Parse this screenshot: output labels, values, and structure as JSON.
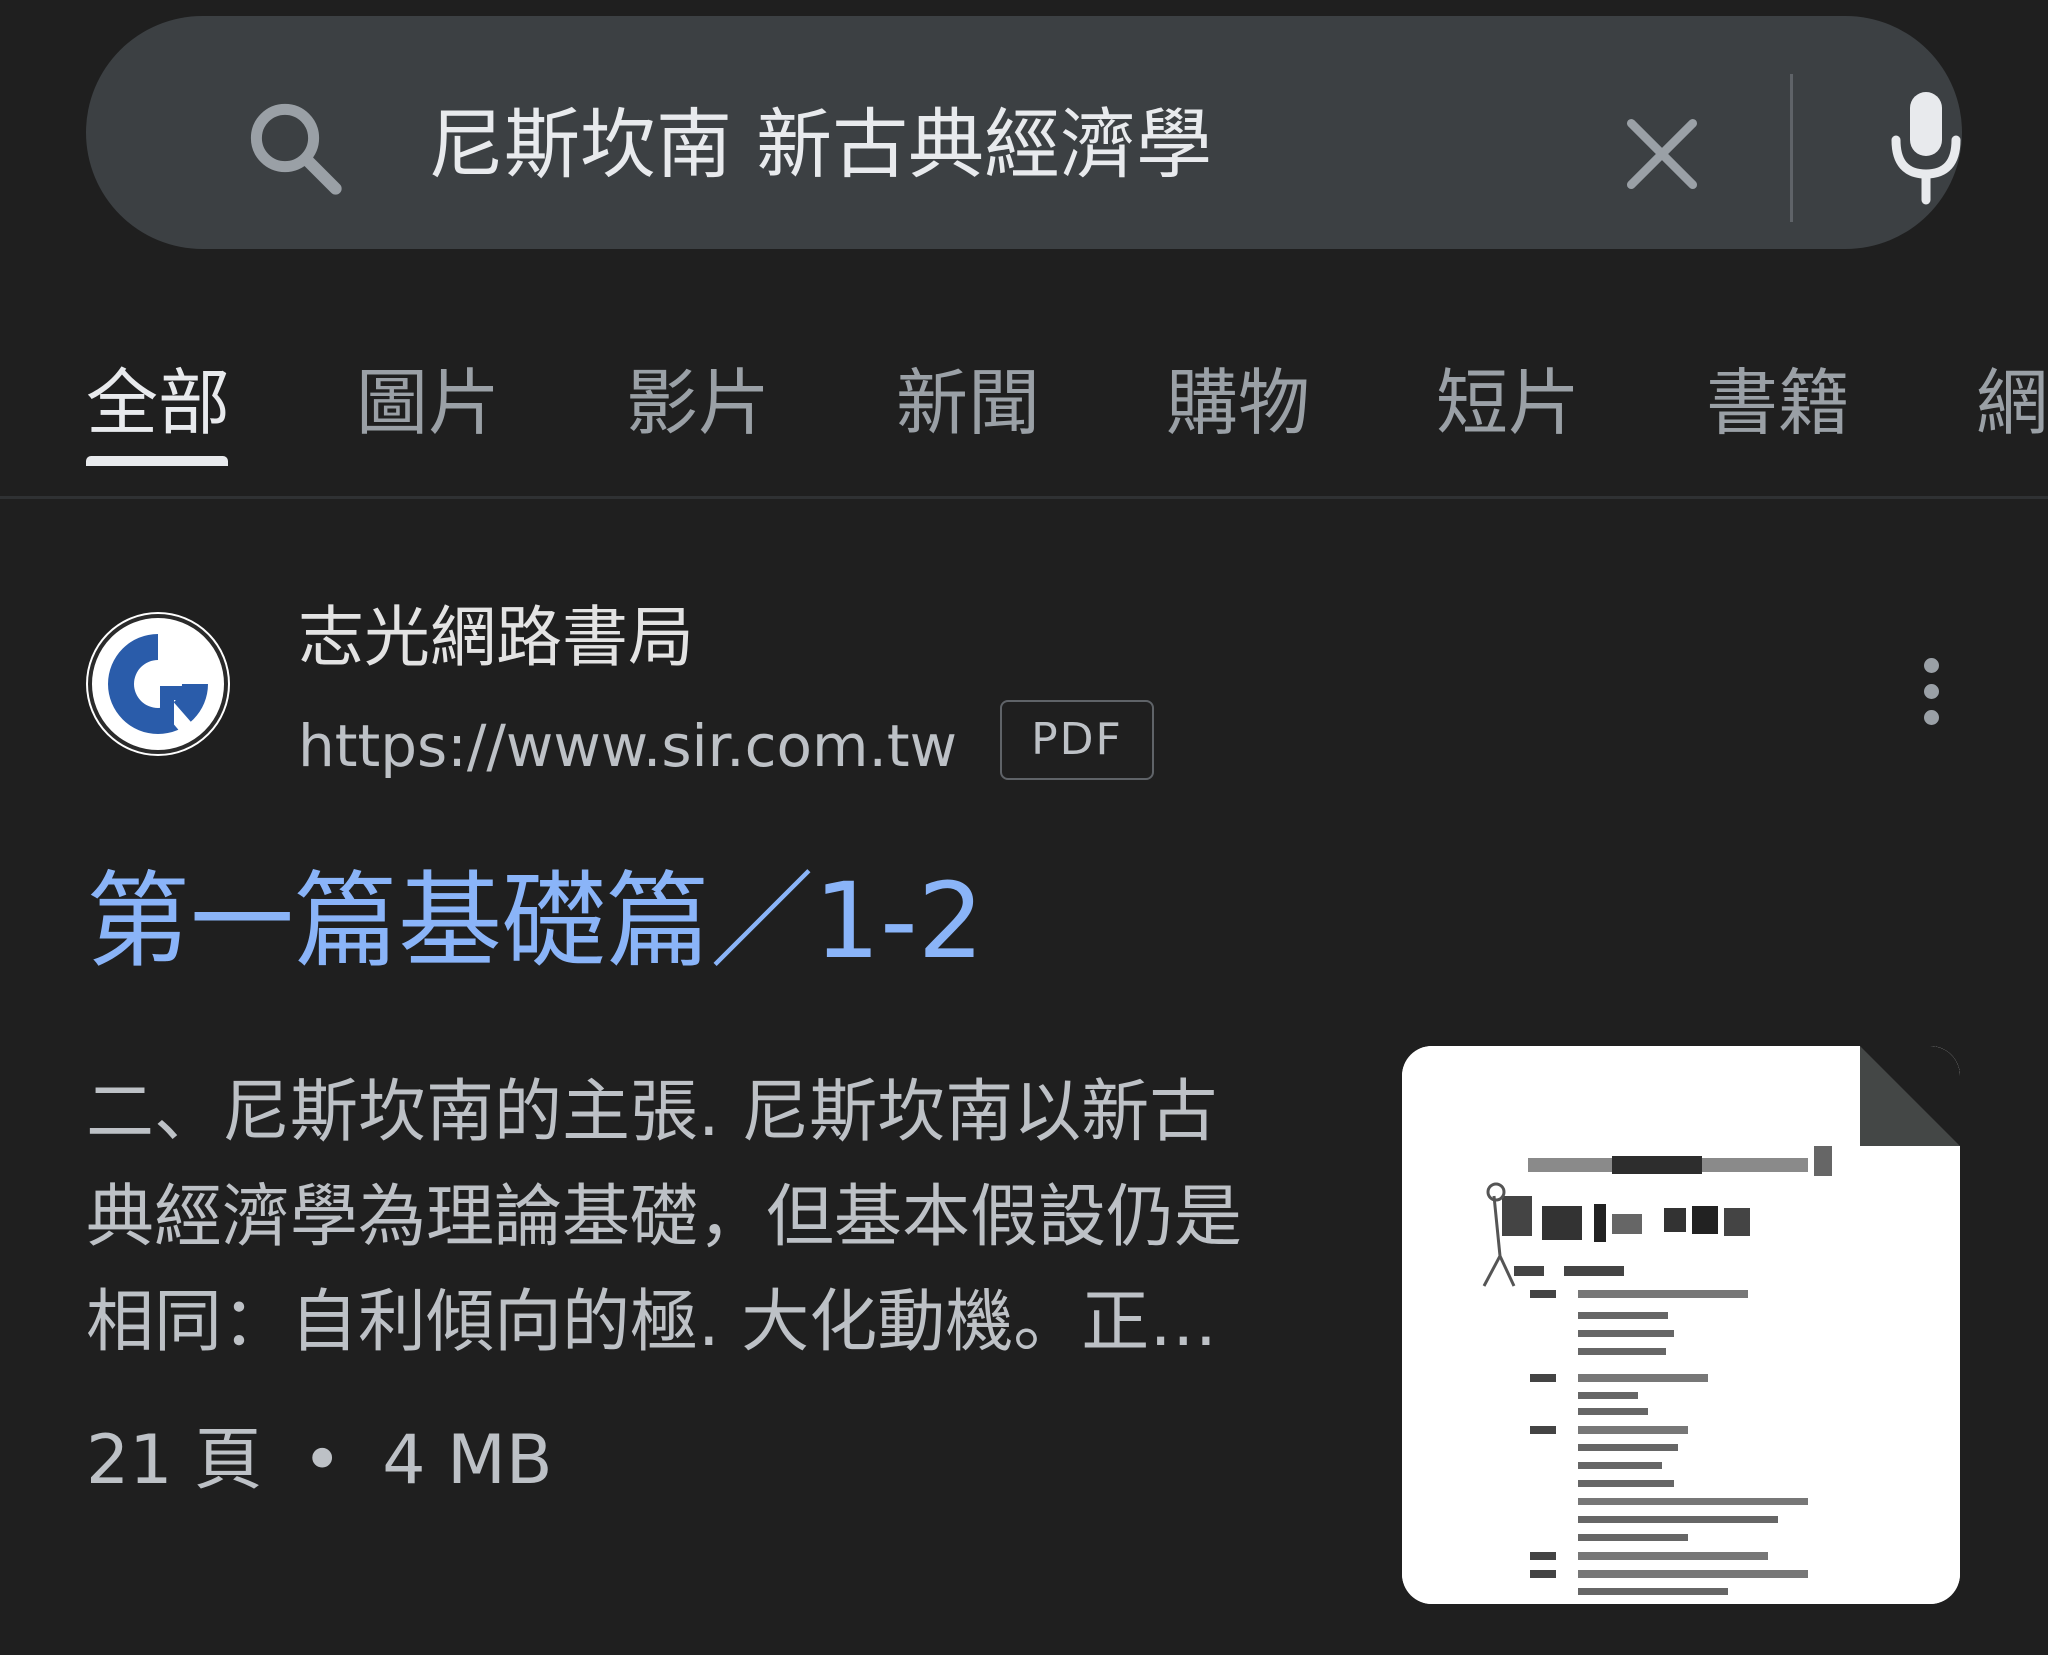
{
  "search": {
    "query": "尼斯坎南 新古典經濟學",
    "search_icon": "search-icon",
    "clear_icon": "close-icon",
    "mic_icon": "microphone-icon"
  },
  "tabs": [
    {
      "label": "全部",
      "active": true
    },
    {
      "label": "圖片"
    },
    {
      "label": "影片"
    },
    {
      "label": "新聞"
    },
    {
      "label": "購物"
    },
    {
      "label": "短片"
    },
    {
      "label": "書籍"
    },
    {
      "label": "網"
    }
  ],
  "result": {
    "site_name": "志光網路書局",
    "url": "https://www.sir.com.tw",
    "badge": "PDF",
    "title": "第一篇基礎篇／1-2",
    "snippet_lines": [
      "二、尼斯坎南的主張. 尼斯坎南以新古",
      "典經濟學為理論基礎，但基本假設仍是",
      "相同：自利傾向的極. 大化動機。正…"
    ],
    "pages": "21 頁",
    "separator": "•",
    "size": "4 MB",
    "more_icon": "more-vert-icon"
  },
  "colors": {
    "background": "#1f1f1f",
    "search_bg": "#3c4043",
    "link": "#8ab4f8",
    "text_primary": "#e8eaed",
    "text_secondary": "#bdc1c6",
    "favicon_blue": "#2a5caa"
  }
}
